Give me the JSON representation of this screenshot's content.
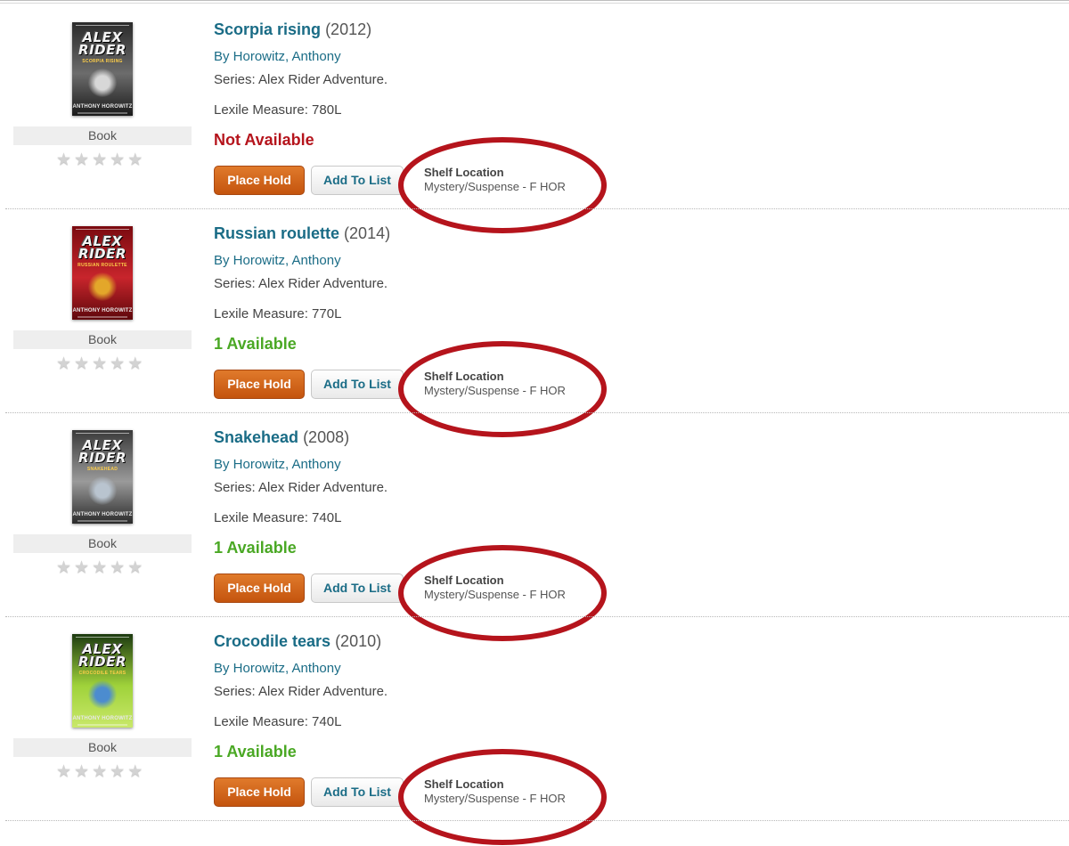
{
  "results": [
    {
      "title": "Scorpia rising",
      "year": "(2012)",
      "author": "By Horowitz, Anthony",
      "series": "Series: Alex Rider Adventure.",
      "lexile": "Lexile Measure: 780L",
      "format": "Book",
      "availability": "Not Available",
      "availability_color": "#b5141c",
      "place_hold_label": "Place Hold",
      "add_to_list_label": "Add To List",
      "shelf_label": "Shelf Location",
      "shelf_value": "Mystery/Suspense - F HOR",
      "rating_stars": 0,
      "cover": {
        "title_line1": "ALEX",
        "title_line2": "RIDER",
        "subtitle": "SCORPIA RISING",
        "author": "ANTHONY HOROWITZ",
        "bg_top": "#2a2a2a",
        "bg_mid": "#6c6c6c",
        "bg_bottom": "#1a1a1a",
        "emblem_color": "#d8d8d8"
      }
    },
    {
      "title": "Russian roulette",
      "year": "(2014)",
      "author": "By Horowitz, Anthony",
      "series": "Series: Alex Rider Adventure.",
      "lexile": "Lexile Measure: 770L",
      "format": "Book",
      "availability": "1 Available",
      "availability_color": "#4aa824",
      "place_hold_label": "Place Hold",
      "add_to_list_label": "Add To List",
      "shelf_label": "Shelf Location",
      "shelf_value": "Mystery/Suspense - F HOR",
      "rating_stars": 0,
      "cover": {
        "title_line1": "ALEX",
        "title_line2": "RIDER",
        "subtitle": "RUSSIAN ROULETTE",
        "author": "ANTHONY HOROWITZ",
        "bg_top": "#7a0a0f",
        "bg_mid": "#c8252c",
        "bg_bottom": "#5e070b",
        "emblem_color": "#e3a72a"
      }
    },
    {
      "title": "Snakehead",
      "year": "(2008)",
      "author": "By Horowitz, Anthony",
      "series": "Series: Alex Rider Adventure.",
      "lexile": "Lexile Measure: 740L",
      "format": "Book",
      "availability": "1 Available",
      "availability_color": "#4aa824",
      "place_hold_label": "Place Hold",
      "add_to_list_label": "Add To List",
      "shelf_label": "Shelf Location",
      "shelf_value": "Mystery/Suspense - F HOR",
      "rating_stars": 0,
      "cover": {
        "title_line1": "ALEX",
        "title_line2": "RIDER",
        "subtitle": "SNAKEHEAD",
        "author": "ANTHONY HOROWITZ",
        "bg_top": "#3a3a3a",
        "bg_mid": "#9a9a9a",
        "bg_bottom": "#2a2a2a",
        "emblem_color": "#b9c4cf"
      }
    },
    {
      "title": "Crocodile tears",
      "year": "(2010)",
      "author": "By Horowitz, Anthony",
      "series": "Series: Alex Rider Adventure.",
      "lexile": "Lexile Measure: 740L",
      "format": "Book",
      "availability": "1 Available",
      "availability_color": "#4aa824",
      "place_hold_label": "Place Hold",
      "add_to_list_label": "Add To List",
      "shelf_label": "Shelf Location",
      "shelf_value": "Mystery/Suspense - F HOR",
      "rating_stars": 0,
      "cover": {
        "title_line1": "ALEX",
        "title_line2": "RIDER",
        "subtitle": "CROCODILE TEARS",
        "author": "ANTHONY HOROWITZ",
        "bg_top": "#1c3a10",
        "bg_mid": "#9fd23a",
        "bg_bottom": "#c9e86a",
        "emblem_color": "#4c8ccf"
      }
    }
  ],
  "colors": {
    "link": "#1a6c86",
    "place_hold_button": "#d2661d",
    "not_available": "#b5141c",
    "available": "#4aa824",
    "annotation_ellipse": "#b5141c",
    "star_empty": "#d3d3d3"
  },
  "icons": {
    "rating_star": "star-icon"
  }
}
